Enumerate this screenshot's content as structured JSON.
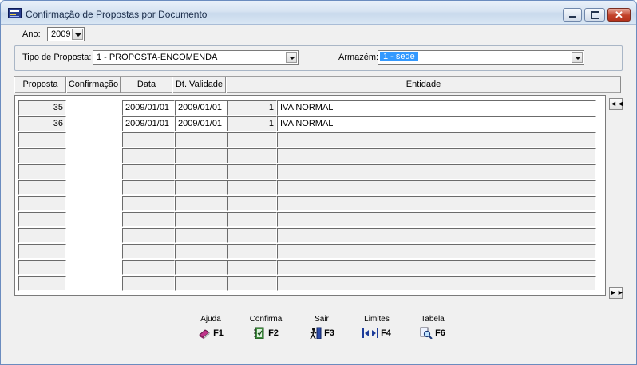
{
  "window": {
    "title": "Confirmação de Propostas por Documento",
    "colors": {
      "accent_selection": "#3399ff",
      "close_button": "#c2422b"
    }
  },
  "filters": {
    "ano_label": "Ano:",
    "ano_value": "2009",
    "tipo_label": "Tipo de Proposta:",
    "tipo_value": "1 - PROPOSTA-ENCOMENDA",
    "armazem_label": "Armazém:",
    "armazem_value": "1 - sede"
  },
  "grid": {
    "columns": [
      "Proposta",
      "Confirmação",
      "Data",
      "Dt. Validade",
      "",
      "Entidade"
    ],
    "rows": [
      [
        "35",
        "",
        "2009/01/01",
        "2009/01/01",
        "1",
        "IVA NORMAL"
      ],
      [
        "36",
        "",
        "2009/01/01",
        "2009/01/01",
        "1",
        "IVA NORMAL"
      ],
      [
        "",
        "",
        "",
        "",
        "",
        ""
      ],
      [
        "",
        "",
        "",
        "",
        "",
        ""
      ],
      [
        "",
        "",
        "",
        "",
        "",
        ""
      ],
      [
        "",
        "",
        "",
        "",
        "",
        ""
      ],
      [
        "",
        "",
        "",
        "",
        "",
        ""
      ],
      [
        "",
        "",
        "",
        "",
        "",
        ""
      ],
      [
        "",
        "",
        "",
        "",
        "",
        ""
      ],
      [
        "",
        "",
        "",
        "",
        "",
        ""
      ],
      [
        "",
        "",
        "",
        "",
        "",
        ""
      ],
      [
        "",
        "",
        "",
        "",
        "",
        ""
      ]
    ],
    "nav_first": "◄◄",
    "nav_last": "►►"
  },
  "function_keys": [
    {
      "label": "Ajuda",
      "key": "F1",
      "icon": "book-icon"
    },
    {
      "label": "Confirma",
      "key": "F2",
      "icon": "notebook-check-icon"
    },
    {
      "label": "Sair",
      "key": "F3",
      "icon": "exit-person-icon"
    },
    {
      "label": "Limites",
      "key": "F4",
      "icon": "limits-arrows-icon"
    },
    {
      "label": "Tabela",
      "key": "F6",
      "icon": "magnifier-icon"
    }
  ]
}
